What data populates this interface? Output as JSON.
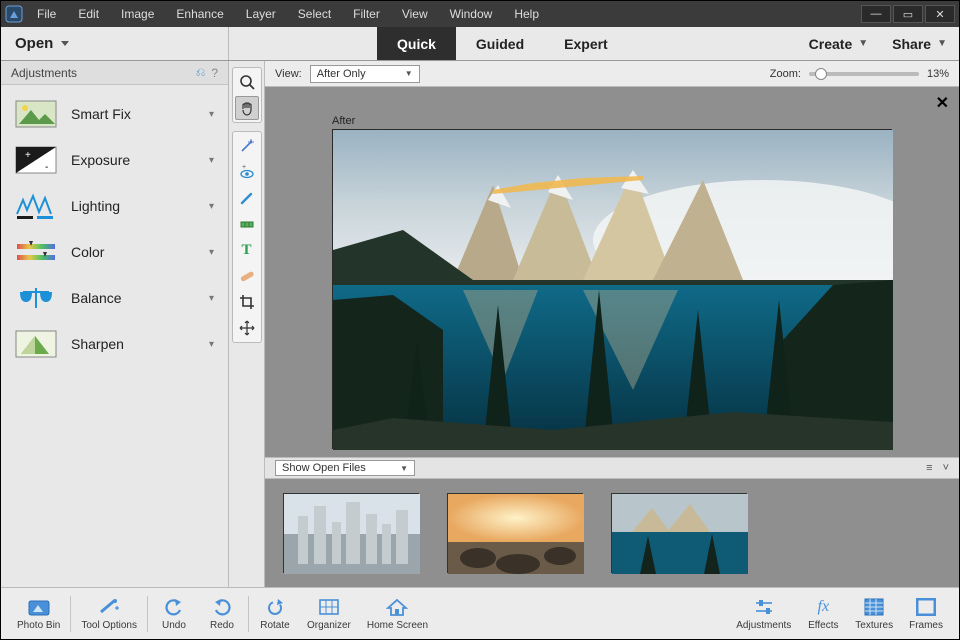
{
  "menubar": {
    "items": [
      "File",
      "Edit",
      "Image",
      "Enhance",
      "Layer",
      "Select",
      "Filter",
      "View",
      "Window",
      "Help"
    ]
  },
  "modebar": {
    "open_label": "Open",
    "tabs": [
      "Quick",
      "Guided",
      "Expert"
    ],
    "active_tab": 0,
    "create_label": "Create",
    "share_label": "Share"
  },
  "left_panel": {
    "title": "Adjustments",
    "items": [
      {
        "label": "Smart Fix",
        "icon": "smartfix"
      },
      {
        "label": "Exposure",
        "icon": "exposure"
      },
      {
        "label": "Lighting",
        "icon": "lighting"
      },
      {
        "label": "Color",
        "icon": "color"
      },
      {
        "label": "Balance",
        "icon": "balance"
      },
      {
        "label": "Sharpen",
        "icon": "sharpen"
      }
    ]
  },
  "tools": {
    "group1": [
      "zoom",
      "hand"
    ],
    "group2": [
      "quick-select",
      "eye",
      "whiten",
      "crop-straighten",
      "type",
      "spot",
      "crop",
      "move"
    ],
    "selected": "hand"
  },
  "viewbar": {
    "view_label": "View:",
    "view_value": "After Only",
    "zoom_label": "Zoom:",
    "zoom_value": "13%"
  },
  "canvas": {
    "after_label": "After"
  },
  "photobin": {
    "selector_value": "Show Open Files",
    "thumb_count": 3
  },
  "bottombar": {
    "left": [
      {
        "label": "Photo Bin",
        "icon": "photobin"
      },
      {
        "label": "Tool Options",
        "icon": "tooloptions"
      },
      {
        "label": "Undo",
        "icon": "undo"
      },
      {
        "label": "Redo",
        "icon": "redo"
      },
      {
        "label": "Rotate",
        "icon": "rotate"
      },
      {
        "label": "Organizer",
        "icon": "organizer"
      },
      {
        "label": "Home Screen",
        "icon": "home"
      }
    ],
    "right": [
      {
        "label": "Adjustments",
        "icon": "sliders"
      },
      {
        "label": "Effects",
        "icon": "fx"
      },
      {
        "label": "Textures",
        "icon": "textures"
      },
      {
        "label": "Frames",
        "icon": "frames"
      }
    ]
  }
}
